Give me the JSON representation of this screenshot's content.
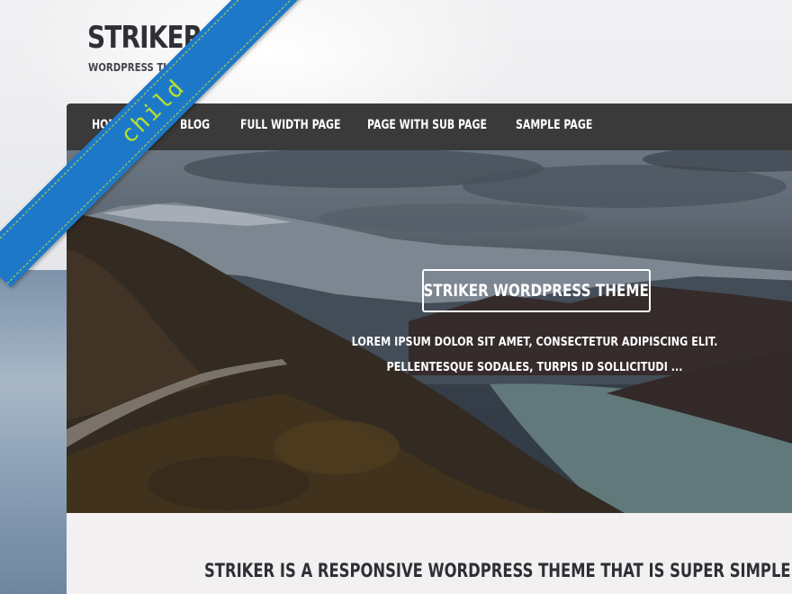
{
  "site": {
    "title": "STRIKER",
    "tagline": "WORDPRESS THEME"
  },
  "nav": {
    "items": [
      {
        "label": "HOME"
      },
      {
        "label": "BLOG"
      },
      {
        "label": "FULL WIDTH PAGE"
      },
      {
        "label": "PAGE WITH SUB PAGE"
      },
      {
        "label": "SAMPLE PAGE"
      }
    ]
  },
  "hero": {
    "title": "STRIKER WORDPRESS THEME",
    "text": "LOREM IPSUM DOLOR SIT AMET, CONSECTETUR ADIPISCING ELIT. PELLENTESQUE SODALES, TURPIS ID SOLLICITUDI ..."
  },
  "intro": {
    "text": "STRIKER IS A RESPONSIVE WORDPRESS THEME THAT IS SUPER SIMPLE TO CUSTOMIZE"
  },
  "ribbon": {
    "label": "child"
  },
  "colors": {
    "navbar": "#3a3a3a",
    "content_bg": "#f3f0f1",
    "ribbon": "#1d79c8",
    "ribbon_text": "#b8e02c",
    "title_text": "#2f3036"
  }
}
